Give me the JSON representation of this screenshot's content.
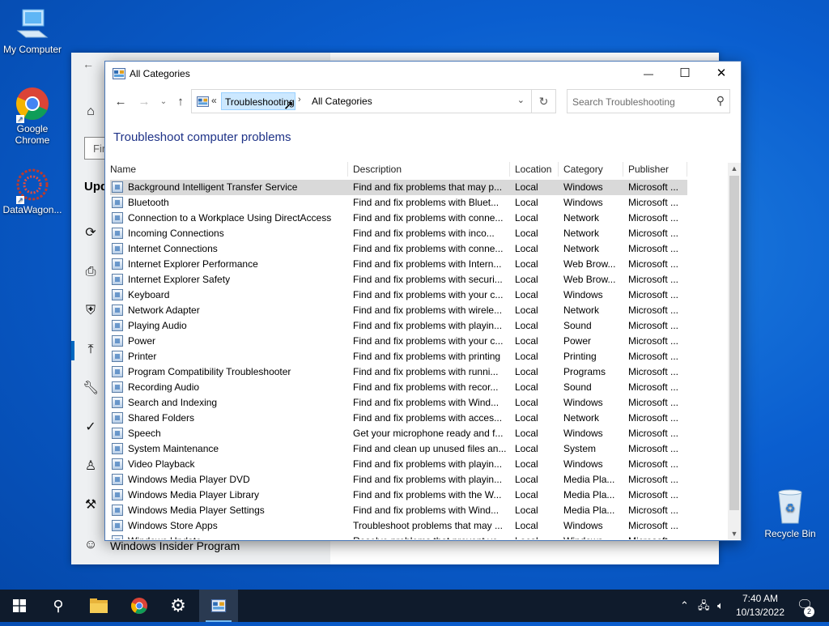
{
  "desktop": {
    "icons": [
      {
        "label": "My Computer"
      },
      {
        "label": "Google Chrome"
      },
      {
        "label": "DataWagon..."
      }
    ],
    "recycle_bin": "Recycle Bin"
  },
  "settings_bg": {
    "find_placeholder": "Fir",
    "section_title": "Upd",
    "insider_item": "Windows Insider Program"
  },
  "window": {
    "title": "All Categories",
    "controls": {
      "minimize": "—",
      "maximize": "☐",
      "close": "✕"
    },
    "address": {
      "prefix": "«",
      "crumbs": [
        "Troubleshooting",
        "All Categories"
      ]
    },
    "search_placeholder": "Search Troubleshooting",
    "heading": "Troubleshoot computer problems",
    "columns": [
      "Name",
      "Description",
      "Location",
      "Category",
      "Publisher"
    ],
    "rows": [
      {
        "name": "Background Intelligent Transfer Service",
        "desc": "Find and fix problems that may p...",
        "loc": "Local",
        "cat": "Windows",
        "pub": "Microsoft ..."
      },
      {
        "name": "Bluetooth",
        "desc": "Find and fix problems with Bluet...",
        "loc": "Local",
        "cat": "Windows",
        "pub": "Microsoft ..."
      },
      {
        "name": "Connection to a Workplace Using DirectAccess",
        "desc": "Find and fix problems with conne...",
        "loc": "Local",
        "cat": "Network",
        "pub": "Microsoft ..."
      },
      {
        "name": "Incoming Connections",
        "desc": "Find and fix problems with inco...",
        "loc": "Local",
        "cat": "Network",
        "pub": "Microsoft ..."
      },
      {
        "name": "Internet Connections",
        "desc": "Find and fix problems with conne...",
        "loc": "Local",
        "cat": "Network",
        "pub": "Microsoft ..."
      },
      {
        "name": "Internet Explorer Performance",
        "desc": "Find and fix problems with Intern...",
        "loc": "Local",
        "cat": "Web Brow...",
        "pub": "Microsoft ..."
      },
      {
        "name": "Internet Explorer Safety",
        "desc": "Find and fix problems with securi...",
        "loc": "Local",
        "cat": "Web Brow...",
        "pub": "Microsoft ..."
      },
      {
        "name": "Keyboard",
        "desc": "Find and fix problems with your c...",
        "loc": "Local",
        "cat": "Windows",
        "pub": "Microsoft ..."
      },
      {
        "name": "Network Adapter",
        "desc": "Find and fix problems with wirele...",
        "loc": "Local",
        "cat": "Network",
        "pub": "Microsoft ..."
      },
      {
        "name": "Playing Audio",
        "desc": "Find and fix problems with playin...",
        "loc": "Local",
        "cat": "Sound",
        "pub": "Microsoft ..."
      },
      {
        "name": "Power",
        "desc": "Find and fix problems with your c...",
        "loc": "Local",
        "cat": "Power",
        "pub": "Microsoft ..."
      },
      {
        "name": "Printer",
        "desc": "Find and fix problems with printing",
        "loc": "Local",
        "cat": "Printing",
        "pub": "Microsoft ..."
      },
      {
        "name": "Program Compatibility Troubleshooter",
        "desc": "Find and fix problems with runni...",
        "loc": "Local",
        "cat": "Programs",
        "pub": "Microsoft ..."
      },
      {
        "name": "Recording Audio",
        "desc": "Find and fix problems with recor...",
        "loc": "Local",
        "cat": "Sound",
        "pub": "Microsoft ..."
      },
      {
        "name": "Search and Indexing",
        "desc": "Find and fix problems with Wind...",
        "loc": "Local",
        "cat": "Windows",
        "pub": "Microsoft ..."
      },
      {
        "name": "Shared Folders",
        "desc": "Find and fix problems with acces...",
        "loc": "Local",
        "cat": "Network",
        "pub": "Microsoft ..."
      },
      {
        "name": "Speech",
        "desc": "Get your microphone ready and f...",
        "loc": "Local",
        "cat": "Windows",
        "pub": "Microsoft ..."
      },
      {
        "name": "System Maintenance",
        "desc": "Find and clean up unused files an...",
        "loc": "Local",
        "cat": "System",
        "pub": "Microsoft ..."
      },
      {
        "name": "Video Playback",
        "desc": "Find and fix problems with playin...",
        "loc": "Local",
        "cat": "Windows",
        "pub": "Microsoft ..."
      },
      {
        "name": "Windows Media Player DVD",
        "desc": "Find and fix problems with playin...",
        "loc": "Local",
        "cat": "Media Pla...",
        "pub": "Microsoft ..."
      },
      {
        "name": "Windows Media Player Library",
        "desc": "Find and fix problems with the W...",
        "loc": "Local",
        "cat": "Media Pla...",
        "pub": "Microsoft ..."
      },
      {
        "name": "Windows Media Player Settings",
        "desc": "Find and fix problems with Wind...",
        "loc": "Local",
        "cat": "Media Pla...",
        "pub": "Microsoft ..."
      },
      {
        "name": "Windows Store Apps",
        "desc": "Troubleshoot problems that may ...",
        "loc": "Local",
        "cat": "Windows",
        "pub": "Microsoft ..."
      },
      {
        "name": "Windows Update",
        "desc": "Resolve problems that prevent yo...",
        "loc": "Local",
        "cat": "Windows",
        "pub": "Microsoft ..."
      }
    ]
  },
  "taskbar": {
    "time": "7:40 AM",
    "date": "10/13/2022",
    "notification_count": "2"
  },
  "colors": {
    "accent": "#0067c0",
    "heading": "#1e3287",
    "selected_row": "#d9d9d9",
    "taskbar": "#0f1b2c"
  }
}
